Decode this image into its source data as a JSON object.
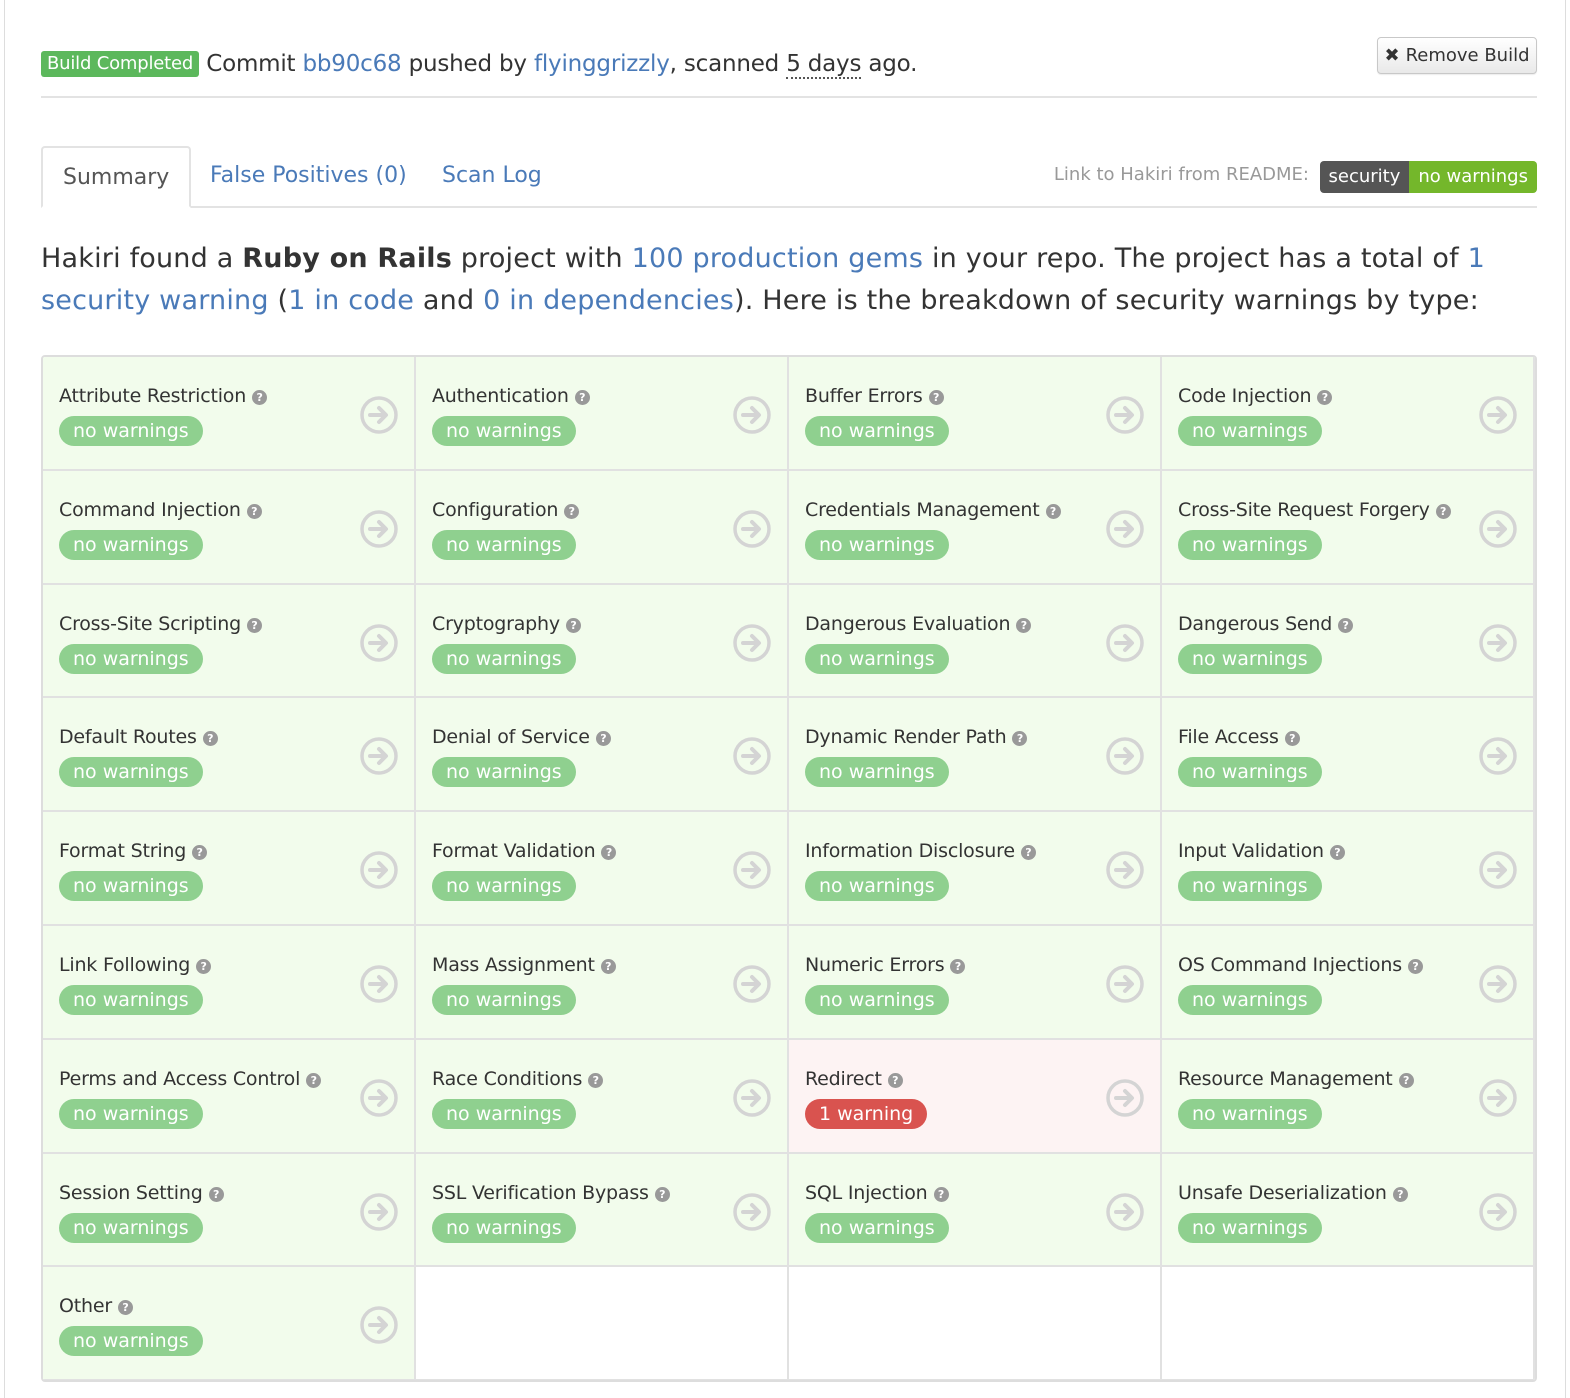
{
  "header": {
    "status_label": "Build Completed",
    "commit_prefix": "Commit",
    "commit_hash": "bb90c68",
    "pushed_by_text": "pushed by",
    "user": "flyinggrizzly",
    "scanned_text": ", scanned",
    "age": "5 days",
    "ago_text": "ago.",
    "remove_button_label": "Remove Build",
    "remove_icon": "times-icon"
  },
  "tabs": [
    {
      "label": "Summary",
      "active": true
    },
    {
      "label": "False Positives (0)",
      "active": false
    },
    {
      "label": "Scan Log",
      "active": false
    }
  ],
  "readme": {
    "label": "Link to Hakiri from README:",
    "badge_left": "security",
    "badge_right": "no warnings"
  },
  "summary": {
    "t1": "Hakiri found a",
    "framework": "Ruby on Rails",
    "t2": "project with",
    "gems_link": "100 production gems",
    "t3": "in your repo. The project has a total of",
    "warnings_link": "1 security warning",
    "t4": "(",
    "code_link": "1 in code",
    "t5": "and",
    "deps_link": "0 in dependencies",
    "t6": "). Here is the breakdown of security warnings by type:"
  },
  "categories": [
    {
      "name": "Attribute Restriction",
      "status": "no warnings",
      "warning": false
    },
    {
      "name": "Authentication",
      "status": "no warnings",
      "warning": false
    },
    {
      "name": "Buffer Errors",
      "status": "no warnings",
      "warning": false
    },
    {
      "name": "Code Injection",
      "status": "no warnings",
      "warning": false
    },
    {
      "name": "Command Injection",
      "status": "no warnings",
      "warning": false
    },
    {
      "name": "Configuration",
      "status": "no warnings",
      "warning": false
    },
    {
      "name": "Credentials Management",
      "status": "no warnings",
      "warning": false
    },
    {
      "name": "Cross-Site Request Forgery",
      "status": "no warnings",
      "warning": false
    },
    {
      "name": "Cross-Site Scripting",
      "status": "no warnings",
      "warning": false
    },
    {
      "name": "Cryptography",
      "status": "no warnings",
      "warning": false
    },
    {
      "name": "Dangerous Evaluation",
      "status": "no warnings",
      "warning": false
    },
    {
      "name": "Dangerous Send",
      "status": "no warnings",
      "warning": false
    },
    {
      "name": "Default Routes",
      "status": "no warnings",
      "warning": false
    },
    {
      "name": "Denial of Service",
      "status": "no warnings",
      "warning": false
    },
    {
      "name": "Dynamic Render Path",
      "status": "no warnings",
      "warning": false
    },
    {
      "name": "File Access",
      "status": "no warnings",
      "warning": false
    },
    {
      "name": "Format String",
      "status": "no warnings",
      "warning": false
    },
    {
      "name": "Format Validation",
      "status": "no warnings",
      "warning": false
    },
    {
      "name": "Information Disclosure",
      "status": "no warnings",
      "warning": false
    },
    {
      "name": "Input Validation",
      "status": "no warnings",
      "warning": false
    },
    {
      "name": "Link Following",
      "status": "no warnings",
      "warning": false
    },
    {
      "name": "Mass Assignment",
      "status": "no warnings",
      "warning": false
    },
    {
      "name": "Numeric Errors",
      "status": "no warnings",
      "warning": false
    },
    {
      "name": "OS Command Injections",
      "status": "no warnings",
      "warning": false
    },
    {
      "name": "Perms and Access Control",
      "status": "no warnings",
      "warning": false
    },
    {
      "name": "Race Conditions",
      "status": "no warnings",
      "warning": false
    },
    {
      "name": "Redirect",
      "status": "1 warning",
      "warning": true
    },
    {
      "name": "Resource Management",
      "status": "no warnings",
      "warning": false
    },
    {
      "name": "Session Setting",
      "status": "no warnings",
      "warning": false
    },
    {
      "name": "SSL Verification Bypass",
      "status": "no warnings",
      "warning": false
    },
    {
      "name": "SQL Injection",
      "status": "no warnings",
      "warning": false
    },
    {
      "name": "Unsafe Deserialization",
      "status": "no warnings",
      "warning": false
    },
    {
      "name": "Other",
      "status": "no warnings",
      "warning": false
    }
  ],
  "icons": {
    "help": "question-circle-icon",
    "arrow": "arrow-circle-right-icon"
  },
  "colors": {
    "link": "#4a7ab8",
    "success": "#5cb85c",
    "ok_pill": "#8fd08f",
    "danger": "#d9534f",
    "ok_cell": "#f2fcec",
    "warn_cell": "#fdf3f3"
  }
}
